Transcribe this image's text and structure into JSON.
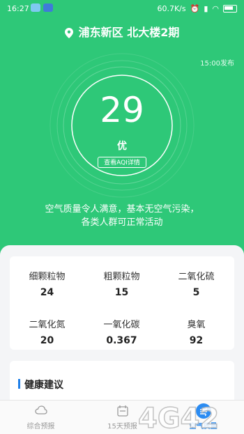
{
  "status_bar": {
    "time": "16:27",
    "network_speed": "60.7K/s"
  },
  "header": {
    "location": "浦东新区 北大楼2期",
    "publish_time": "15:00发布"
  },
  "aqi": {
    "value": "29",
    "level": "优",
    "detail_button": "查看AQI详情",
    "summary_line1": "空气质量令人满意，基本无空气污染，",
    "summary_line2": "各类人群可正常活动"
  },
  "pollutants": [
    {
      "name": "细颗粒物",
      "value": "24"
    },
    {
      "name": "粗颗粒物",
      "value": "15"
    },
    {
      "name": "二氧化硫",
      "value": "5"
    },
    {
      "name": "二氧化氮",
      "value": "20"
    },
    {
      "name": "一氧化碳",
      "value": "0.367"
    },
    {
      "name": "臭氧",
      "value": "92"
    }
  ],
  "health": {
    "title": "健康建议"
  },
  "bottom_nav": {
    "items": [
      {
        "label": "综合预报",
        "icon": "cloud-icon"
      },
      {
        "label": "15天预报",
        "icon": "calendar-icon"
      },
      {
        "label": "空气质量",
        "icon": "air-quality-icon"
      }
    ]
  },
  "colors": {
    "primary_green": "#2ec878",
    "accent_blue": "#2a8bf2"
  },
  "watermark": {
    "text": "4G42"
  }
}
